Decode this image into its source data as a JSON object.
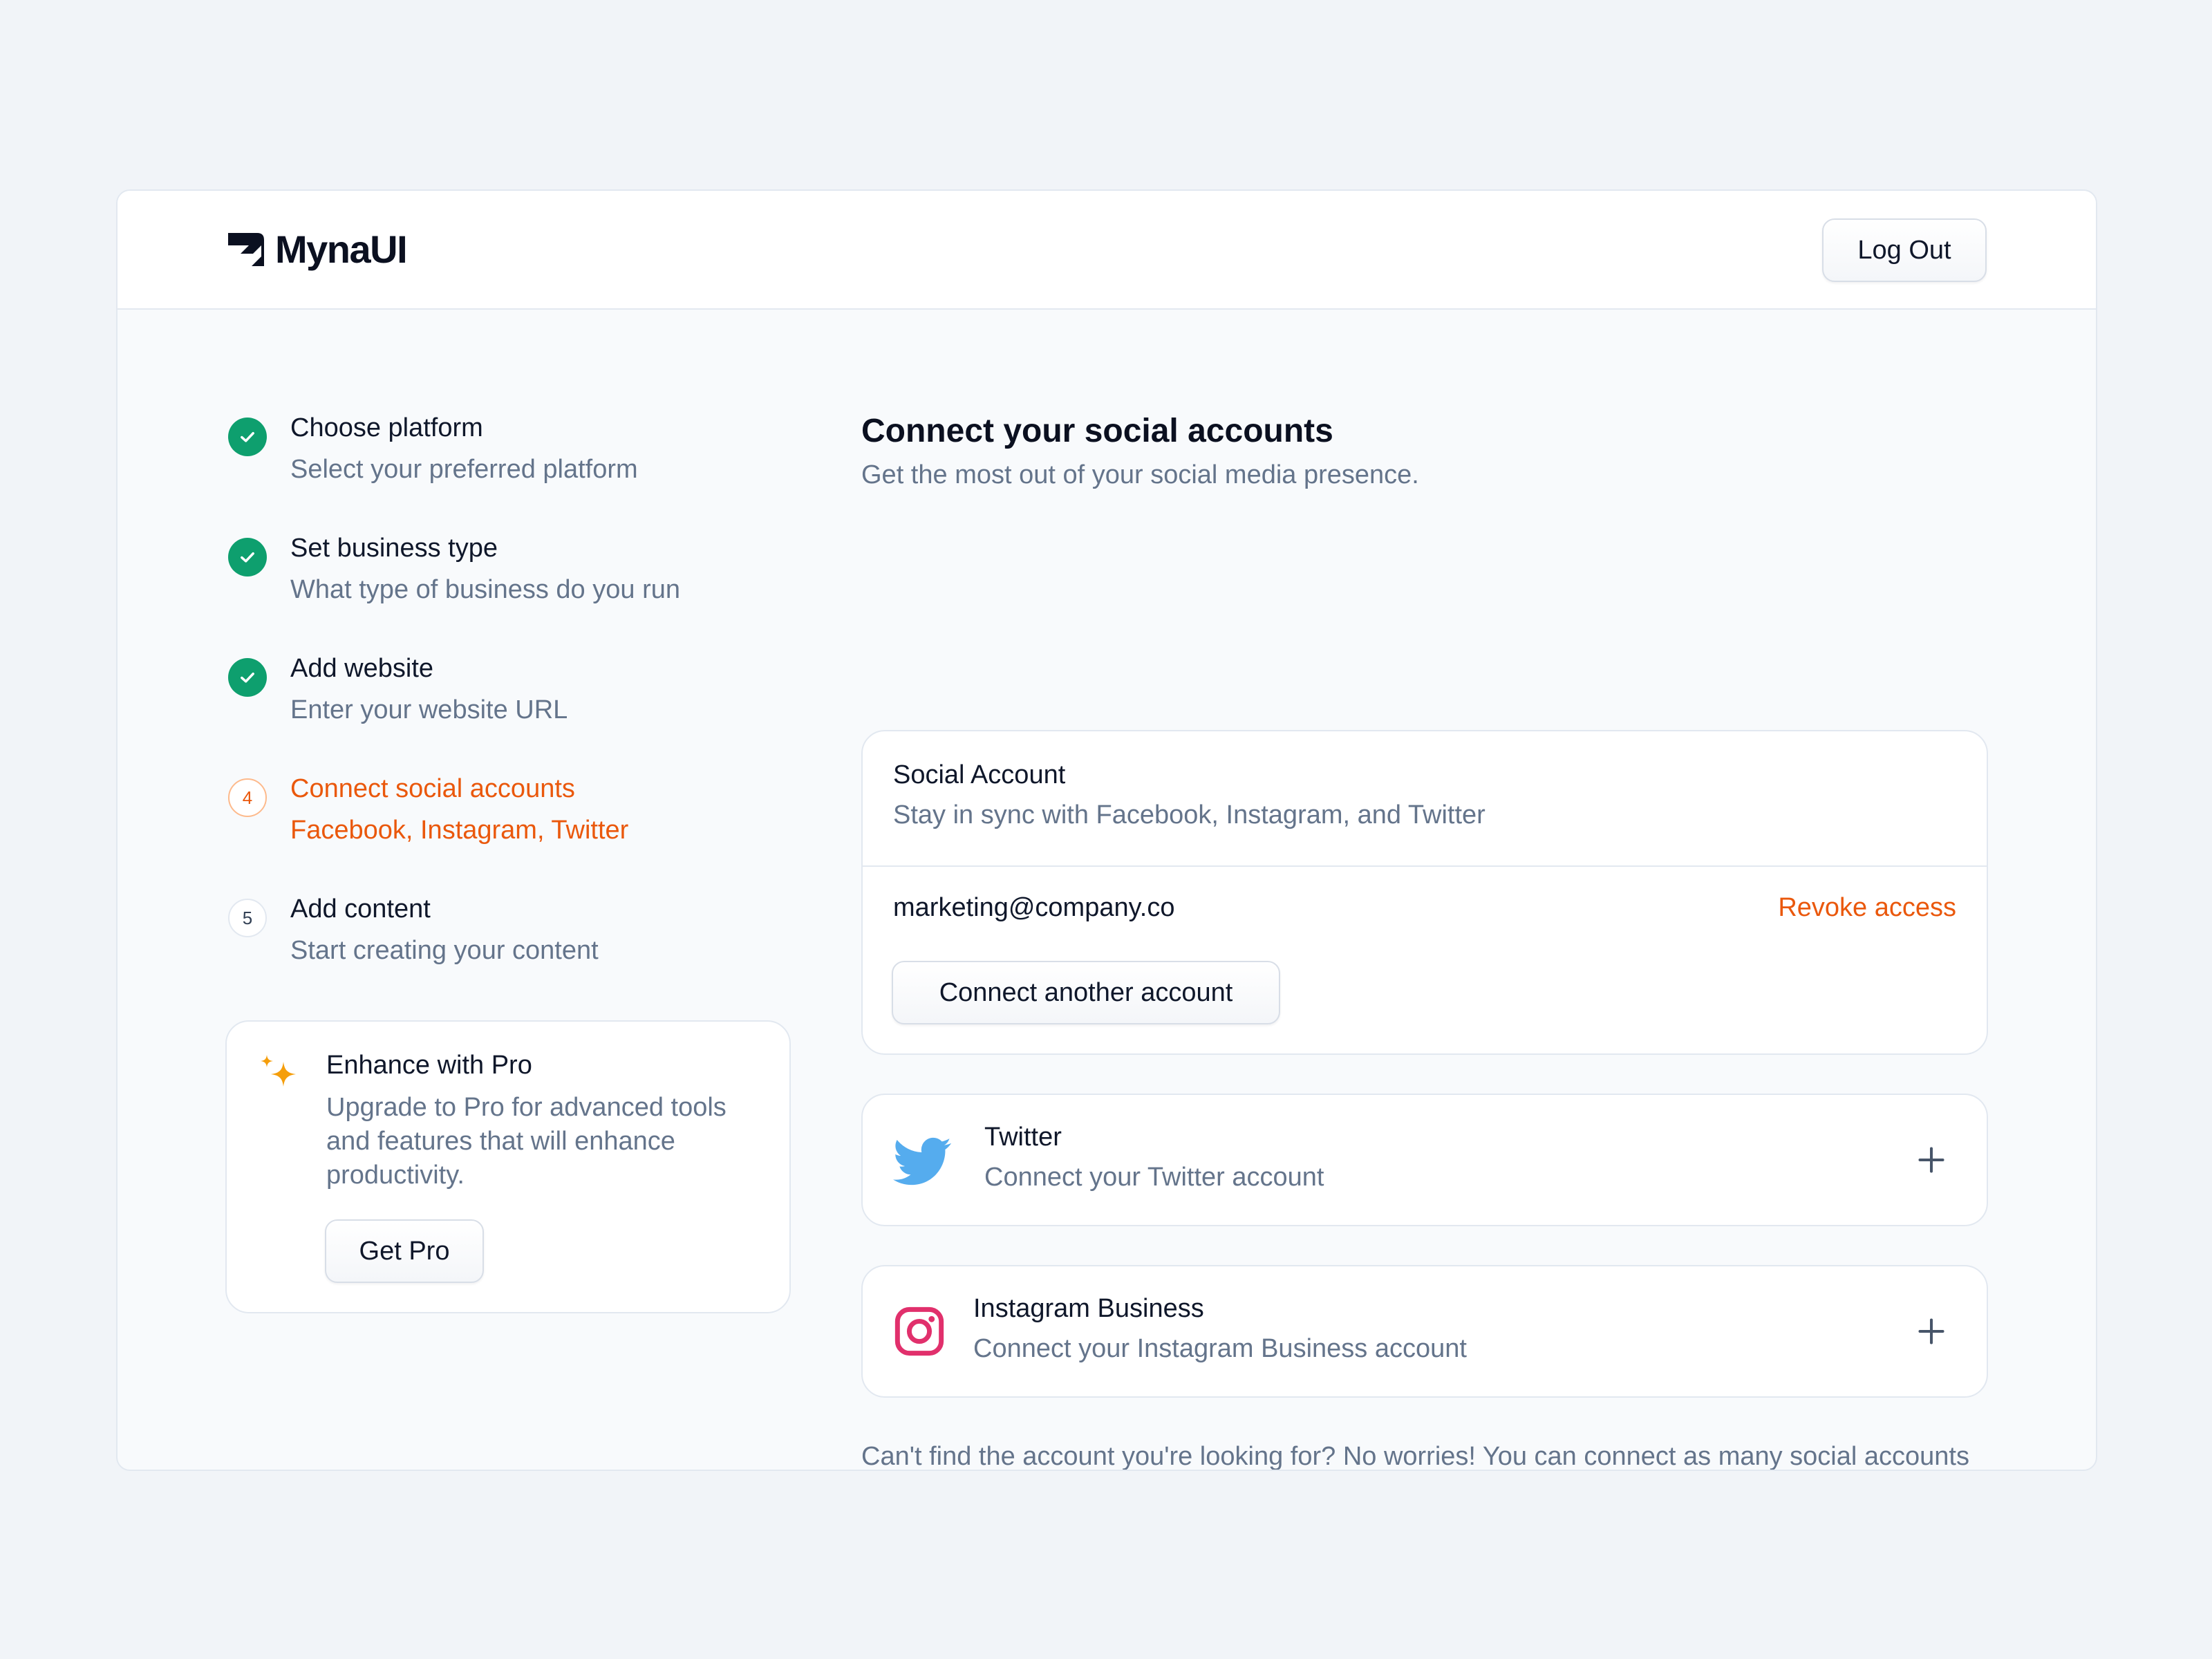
{
  "brand": {
    "name": "MynaUI"
  },
  "header": {
    "logout_label": "Log Out"
  },
  "steps": [
    {
      "number": "1",
      "title": "Choose platform",
      "subtitle": "Select your preferred platform",
      "status": "complete"
    },
    {
      "number": "2",
      "title": "Set business type",
      "subtitle": "What type of business do you run",
      "status": "complete"
    },
    {
      "number": "3",
      "title": "Add website",
      "subtitle": "Enter your website URL",
      "status": "complete"
    },
    {
      "number": "4",
      "title": "Connect social accounts",
      "subtitle": "Facebook, Instagram, Twitter",
      "status": "current"
    },
    {
      "number": "5",
      "title": "Add content",
      "subtitle": "Start creating your content",
      "status": "upcoming"
    }
  ],
  "pro": {
    "title": "Enhance with Pro",
    "body": "Upgrade to Pro for advanced tools and features that will enhance productivity.",
    "button_label": "Get Pro"
  },
  "main": {
    "title": "Connect your social accounts",
    "subtitle": "Get the most out of your social media presence."
  },
  "social_account": {
    "title": "Social Account",
    "subtitle": "Stay in sync with Facebook, Instagram, and Twitter",
    "email": "marketing@company.co",
    "revoke_label": "Revoke access",
    "connect_another_label": "Connect another account"
  },
  "integrations": [
    {
      "name": "Twitter",
      "description": "Connect your Twitter account",
      "icon": "twitter-icon"
    },
    {
      "name": "Instagram Business",
      "description": "Connect your Instagram Business account",
      "icon": "instagram-icon"
    }
  ],
  "footer_note": "Can't find the account you're looking for? No worries! You can connect as many social accounts as you want, making it easier to manage everything in one place. Plus, if you ever change your mind, you can revoke access at any time with just a few clicks.",
  "colors": {
    "accent": "#ea580c",
    "success": "#0e9f6e",
    "twitter": "#55acee",
    "instagram": "#e1306c",
    "pro_star": "#f59e0b"
  }
}
